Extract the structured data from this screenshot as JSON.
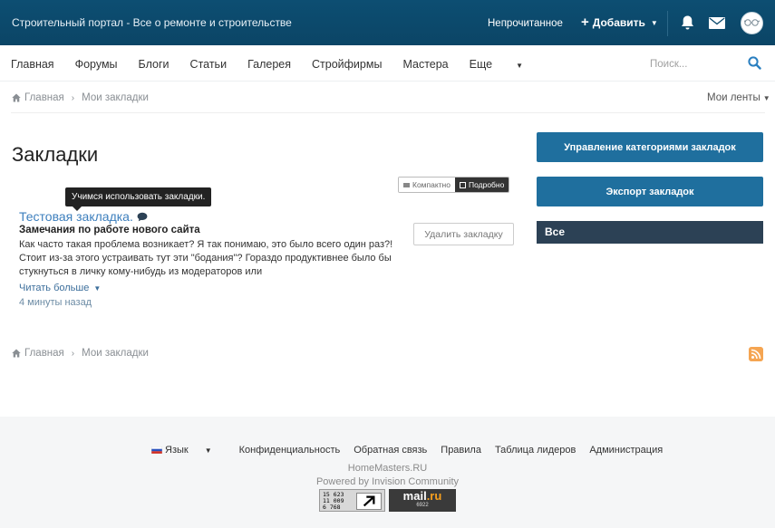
{
  "header": {
    "site_title": "Строительный портал - Все о ремонте и строительстве",
    "unread": "Непрочитанное",
    "add_label": "Добавить"
  },
  "nav": {
    "items": [
      "Главная",
      "Форумы",
      "Блоги",
      "Статьи",
      "Галерея",
      "Стройфирмы",
      "Мастера"
    ],
    "more": "Еще",
    "search_placeholder": "Поиск..."
  },
  "breadcrumb": {
    "home": "Главная",
    "current": "Мои закладки"
  },
  "my_feeds": "Мои ленты",
  "page_title": "Закладки",
  "view_toggle": {
    "compact": "Компактно",
    "detailed": "Подробно"
  },
  "bookmark": {
    "tooltip": "Учимся использовать закладки.",
    "title": "Тестовая закладка.",
    "heading": "Замечания по работе нового сайта",
    "excerpt": "Как часто такая проблема возникает? Я так понимаю, это было всего один раз?! Стоит из-за этого устраивать тут эти \"бодания\"? Гораздо продуктивнее было бы стукнуться в личку кому-нибудь из модераторов или",
    "read_more": "Читать больше",
    "time": "4 минуты назад",
    "delete_label": "Удалить закладку"
  },
  "sidebar": {
    "manage_label": "Управление категориями закладок",
    "export_label": "Экспорт закладок",
    "all_label": "Все"
  },
  "footer": {
    "language": "Язык",
    "links": [
      "Конфиденциальность",
      "Обратная связь",
      "Правила",
      "Таблица лидеров",
      "Администрация"
    ],
    "site_name": "HomeMasters.RU",
    "powered_by": "Powered by Invision Community",
    "counter_lines": [
      "15 623",
      "11 009",
      "6 768"
    ],
    "mailru_brand": "mail",
    "mailru_tld": ".ru",
    "mailru_count": "6922"
  },
  "colors": {
    "header_bg": "#0c4a6e",
    "accent_button": "#1f6f9e",
    "link": "#3d7fbd",
    "sidebar_header": "#2c4155",
    "rss": "#f5a552"
  }
}
